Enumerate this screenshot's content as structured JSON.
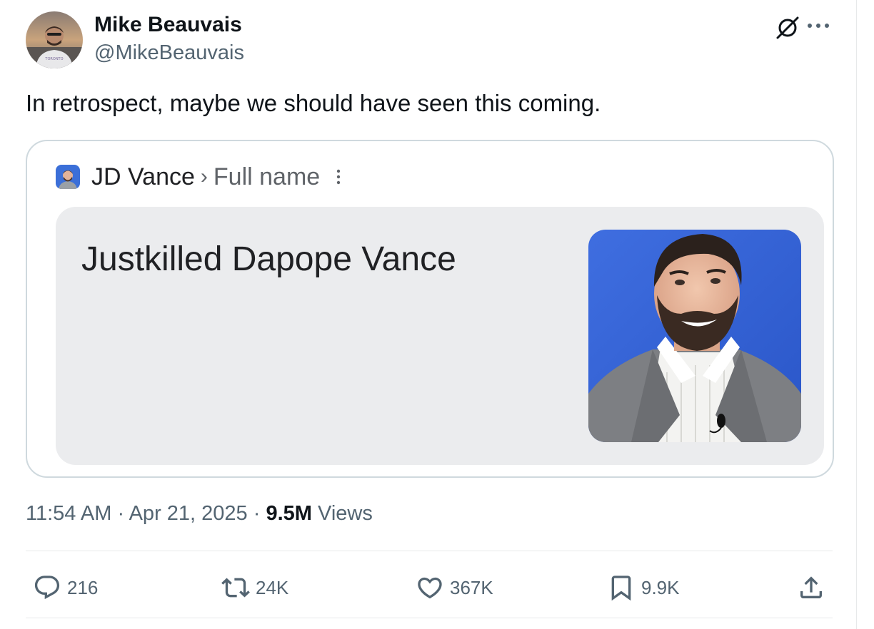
{
  "author": {
    "name": "Mike Beauvais",
    "handle": "@MikeBeauvais"
  },
  "tweet": {
    "text": "In retrospect, maybe we should have seen this coming."
  },
  "media": {
    "entity": "JD Vance",
    "separator": "›",
    "attribute": "Full name",
    "answer": "Justkilled Dapope Vance"
  },
  "meta": {
    "time": "11:54 AM",
    "dot1": "·",
    "date": "Apr 21, 2025",
    "dot2": "·",
    "views_count": "9.5M",
    "views_label": "Views"
  },
  "actions": {
    "replies": "216",
    "reposts": "24K",
    "likes": "367K",
    "bookmarks": "9.9K"
  },
  "icons": {
    "grok": "grok-icon",
    "more": "more-icon",
    "reply": "reply-icon",
    "repost": "repost-icon",
    "like": "heart-icon",
    "bookmark": "bookmark-icon",
    "share": "share-icon"
  },
  "colors": {
    "text_primary": "#0f1419",
    "text_secondary": "#536471",
    "border": "#cfd9de",
    "answer_bg": "#ebecee"
  }
}
